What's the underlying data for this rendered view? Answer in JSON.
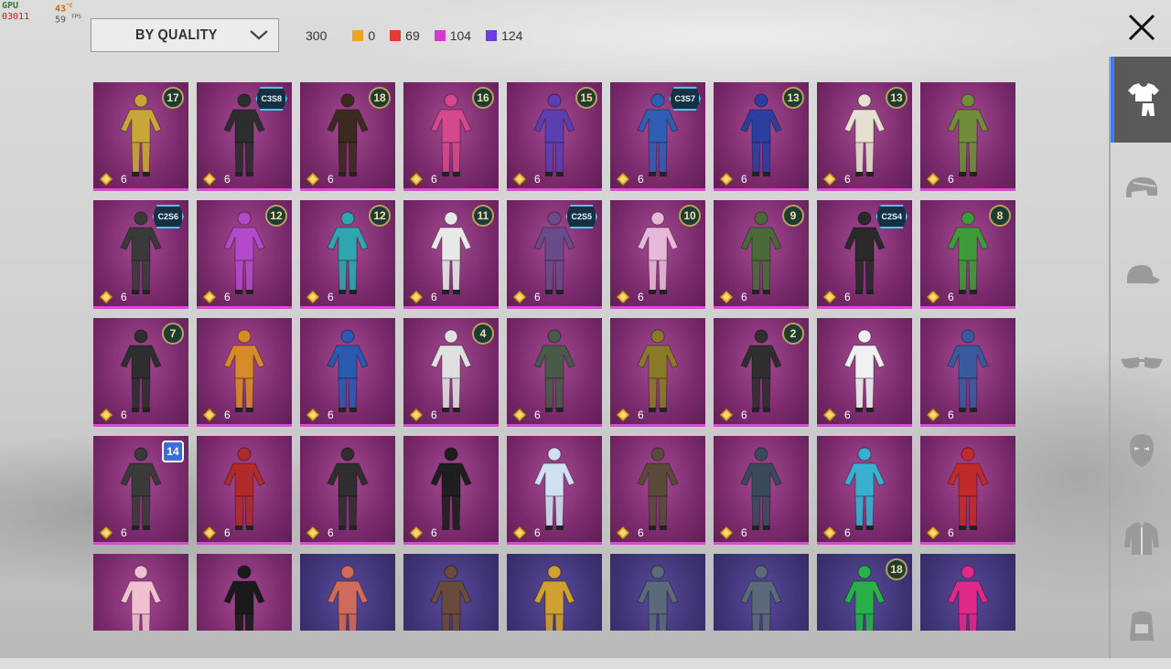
{
  "hud": {
    "gpu": "GPU",
    "cpu": "03011",
    "temp": "43",
    "temp_unit": "°C",
    "fps": "59",
    "fps_unit": "FPS"
  },
  "filter": {
    "label": "BY QUALITY"
  },
  "counts": {
    "total": "300",
    "legendary": {
      "value": "0",
      "color": "#f0a321"
    },
    "mythic": {
      "value": "69",
      "color": "#e53935"
    },
    "epic": {
      "value": "104",
      "color": "#d33bd0"
    },
    "rare": {
      "value": "124",
      "color": "#6a3de0"
    }
  },
  "sidebar": {
    "items": [
      {
        "name": "outfit-icon",
        "active": true
      },
      {
        "name": "helmet-icon",
        "active": false
      },
      {
        "name": "cap-icon",
        "active": false
      },
      {
        "name": "glasses-icon",
        "active": false
      },
      {
        "name": "mask-icon",
        "active": false
      },
      {
        "name": "jacket-icon",
        "active": false
      },
      {
        "name": "backpack-icon",
        "active": false
      }
    ]
  },
  "grid": {
    "rows": [
      [
        {
          "badge": "17",
          "cost": "6",
          "tier": "purple",
          "c": "#c9a63a"
        },
        {
          "badge": "C3S8",
          "cost": "6",
          "tier": "purple",
          "c": "#2d2d2d",
          "season": true
        },
        {
          "badge": "18",
          "cost": "6",
          "tier": "purple",
          "c": "#3b2a20"
        },
        {
          "badge": "16",
          "cost": "6",
          "tier": "purple",
          "c": "#d4488e"
        },
        {
          "badge": "15",
          "cost": "6",
          "tier": "purple",
          "c": "#5b3fb0"
        },
        {
          "badge": "C3S7",
          "cost": "6",
          "tier": "purple",
          "c": "#2f5fb5",
          "season": true
        },
        {
          "badge": "13",
          "cost": "6",
          "tier": "purple",
          "c": "#2c3fa0"
        },
        {
          "badge": "13",
          "cost": "6",
          "tier": "purple",
          "c": "#e7dfcf"
        },
        {
          "badge": "",
          "cost": "6",
          "tier": "purple",
          "c": "#6f8d3a"
        }
      ],
      [
        {
          "badge": "C2S6",
          "cost": "6",
          "tier": "purple",
          "c": "#3a3a3a",
          "season": true
        },
        {
          "badge": "12",
          "cost": "6",
          "tier": "purple",
          "c": "#b34ac9"
        },
        {
          "badge": "12",
          "cost": "6",
          "tier": "purple",
          "c": "#2fa6b0"
        },
        {
          "badge": "11",
          "cost": "6",
          "tier": "purple",
          "c": "#e8e8e8"
        },
        {
          "badge": "C2S5",
          "cost": "6",
          "tier": "purple",
          "c": "#6a4b8a",
          "season": true
        },
        {
          "badge": "10",
          "cost": "6",
          "tier": "purple",
          "c": "#e8b8d8"
        },
        {
          "badge": "9",
          "cost": "6",
          "tier": "purple",
          "c": "#4a6a3a"
        },
        {
          "badge": "C2S4",
          "cost": "6",
          "tier": "purple",
          "c": "#2a2a2a",
          "season": true
        },
        {
          "badge": "8",
          "cost": "6",
          "tier": "purple",
          "c": "#3f9a3a"
        }
      ],
      [
        {
          "badge": "7",
          "cost": "6",
          "tier": "purple",
          "c": "#2e2e2e"
        },
        {
          "badge": "",
          "cost": "6",
          "tier": "purple",
          "c": "#d68a2a"
        },
        {
          "badge": "",
          "cost": "6",
          "tier": "purple",
          "c": "#2a5ab0"
        },
        {
          "badge": "4",
          "cost": "6",
          "tier": "purple",
          "c": "#e0e0e0"
        },
        {
          "badge": "",
          "cost": "6",
          "tier": "purple",
          "c": "#4a5a4a"
        },
        {
          "badge": "",
          "cost": "6",
          "tier": "purple",
          "c": "#8a7a2a"
        },
        {
          "badge": "2",
          "cost": "6",
          "tier": "purple",
          "c": "#2e2e2e"
        },
        {
          "badge": "",
          "cost": "6",
          "tier": "purple",
          "c": "#f0f0f0"
        },
        {
          "badge": "",
          "cost": "6",
          "tier": "purple",
          "c": "#3a5aa0"
        }
      ],
      [
        {
          "badge": "14",
          "cost": "6",
          "tier": "purple",
          "c": "#3a3a3a",
          "special": true
        },
        {
          "badge": "",
          "cost": "6",
          "tier": "purple",
          "c": "#b02a2a"
        },
        {
          "badge": "",
          "cost": "6",
          "tier": "purple",
          "c": "#2e2e2e"
        },
        {
          "badge": "",
          "cost": "6",
          "tier": "purple",
          "c": "#1e1e1e"
        },
        {
          "badge": "",
          "cost": "6",
          "tier": "purple",
          "c": "#cfe0f0"
        },
        {
          "badge": "",
          "cost": "6",
          "tier": "purple",
          "c": "#5a4a3a"
        },
        {
          "badge": "",
          "cost": "6",
          "tier": "purple",
          "c": "#3a4a5a"
        },
        {
          "badge": "",
          "cost": "6",
          "tier": "purple",
          "c": "#3ab0d0"
        },
        {
          "badge": "",
          "cost": "6",
          "tier": "purple",
          "c": "#c02a2a"
        }
      ],
      [
        {
          "badge": "",
          "cost": "",
          "tier": "purple",
          "c": "#f0c0d0"
        },
        {
          "badge": "",
          "cost": "",
          "tier": "purple",
          "c": "#1a1a1a"
        },
        {
          "badge": "",
          "cost": "",
          "tier": "blue",
          "c": "#d06a5a"
        },
        {
          "badge": "",
          "cost": "",
          "tier": "blue",
          "c": "#6a4a3a"
        },
        {
          "badge": "",
          "cost": "",
          "tier": "blue",
          "c": "#d0a030"
        },
        {
          "badge": "",
          "cost": "",
          "tier": "blue",
          "c": "#5a6a7a"
        },
        {
          "badge": "",
          "cost": "",
          "tier": "blue",
          "c": "#5a6a7a"
        },
        {
          "badge": "18",
          "cost": "",
          "tier": "blue",
          "c": "#2ab04a"
        },
        {
          "badge": "",
          "cost": "",
          "tier": "blue",
          "c": "#e02a8a"
        }
      ]
    ]
  }
}
